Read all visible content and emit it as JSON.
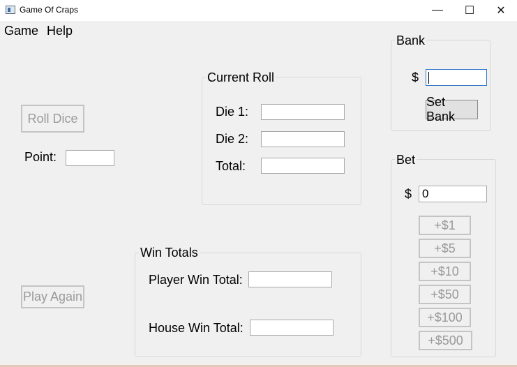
{
  "window": {
    "title": "Game Of Craps",
    "minimize_glyph": "—",
    "maximize_glyph": "☐",
    "close_glyph": "✕"
  },
  "menu": {
    "game": "Game",
    "help": "Help"
  },
  "left": {
    "roll_dice": "Roll Dice",
    "point_label": "Point:",
    "point_value": "",
    "play_again": "Play Again"
  },
  "current_roll": {
    "title": "Current Roll",
    "die1_label": "Die 1:",
    "die1_value": "",
    "die2_label": "Die 2:",
    "die2_value": "",
    "total_label": "Total:",
    "total_value": ""
  },
  "win_totals": {
    "title": "Win Totals",
    "player_label": "Player Win Total:",
    "player_value": "",
    "house_label": "House Win Total:",
    "house_value": ""
  },
  "bank": {
    "title": "Bank",
    "currency": "$",
    "value": "",
    "set_bank": "Set Bank"
  },
  "bet": {
    "title": "Bet",
    "currency": "$",
    "value": "0",
    "buttons": [
      "+$1",
      "+$5",
      "+$10",
      "+$50",
      "+$100",
      "+$500"
    ]
  }
}
